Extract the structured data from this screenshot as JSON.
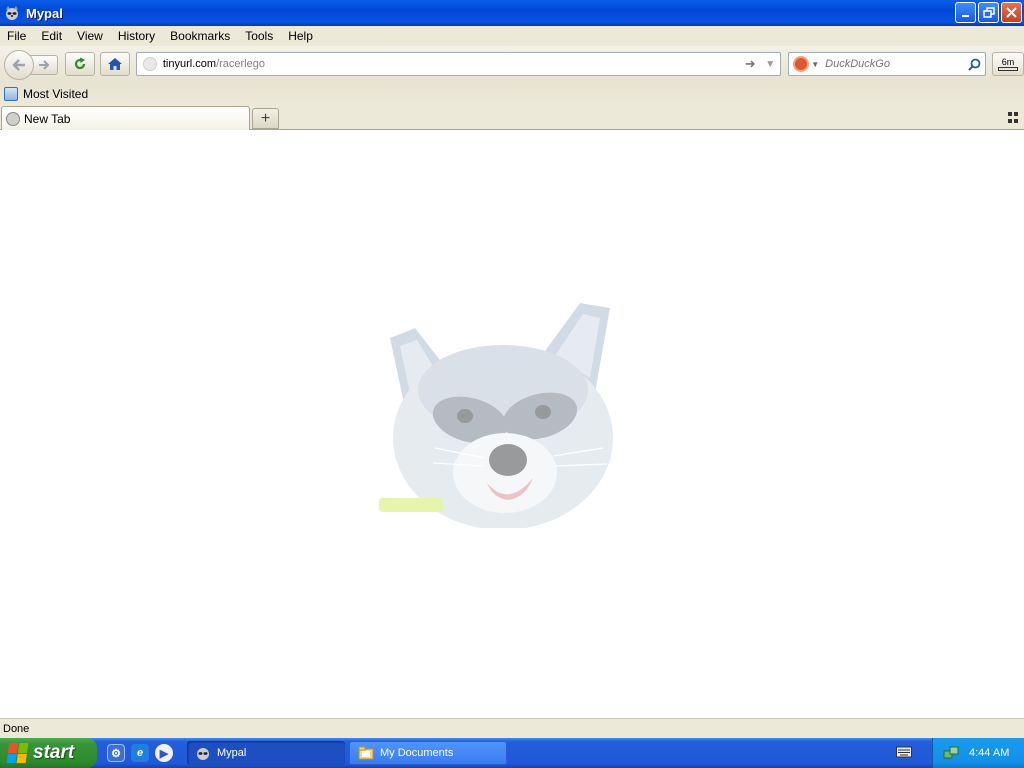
{
  "window": {
    "title": "Mypal"
  },
  "menu": [
    "File",
    "Edit",
    "View",
    "History",
    "Bookmarks",
    "Tools",
    "Help"
  ],
  "nav": {
    "url_host": "tinyurl.com",
    "url_path": "/racerlego",
    "search_placeholder": "DuckDuckGo",
    "ext_label": "6m"
  },
  "bookmarks": {
    "most_visited": "Most Visited"
  },
  "tabs": [
    {
      "label": "New Tab"
    }
  ],
  "newtab_symbol": "+",
  "status": "Done",
  "taskbar": {
    "start_label": "start",
    "tasks": [
      {
        "label": "Mypal",
        "active": true
      },
      {
        "label": "My Documents",
        "active": false
      }
    ],
    "clock": "4:44 AM"
  },
  "colors": {
    "titlebar": "#0a5ee8",
    "start": "#389438",
    "taskbar": "#245edb",
    "tray": "#1290e8"
  },
  "icons": [
    "back-icon",
    "forward-icon",
    "reload-icon",
    "home-icon",
    "go-arrow-icon",
    "search-icon",
    "raccoon-logo"
  ]
}
